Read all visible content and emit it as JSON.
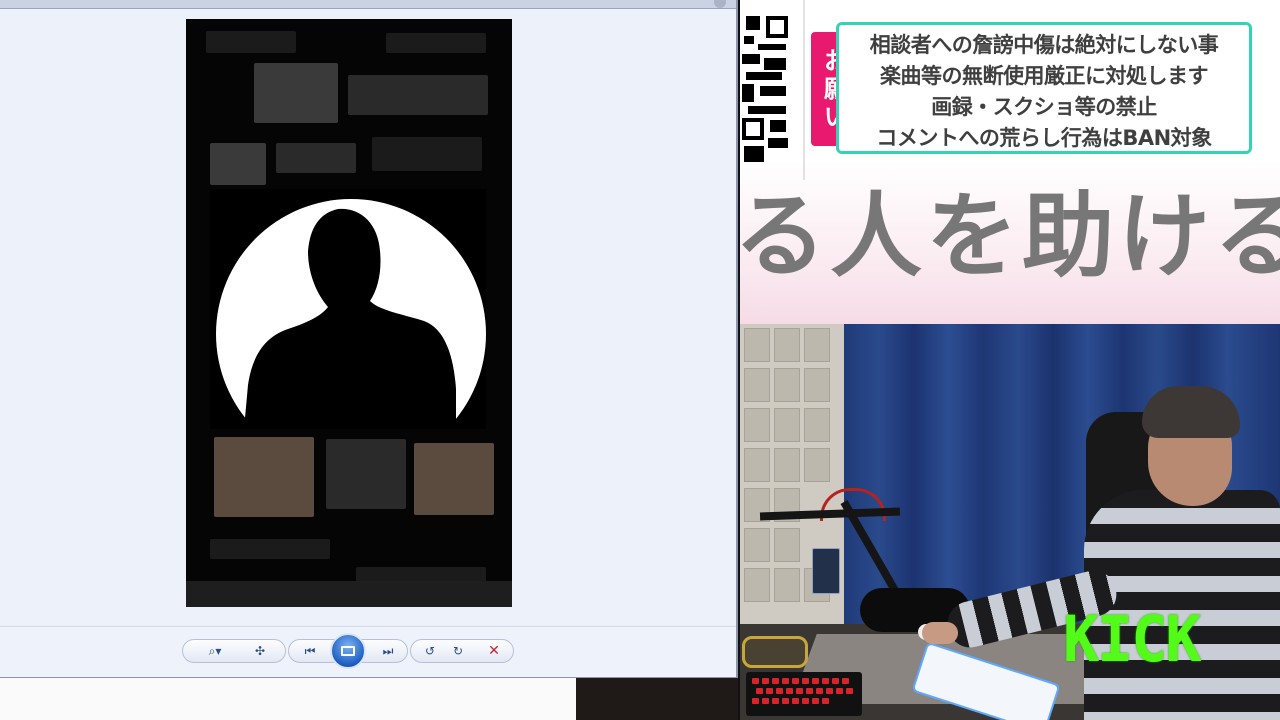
{
  "viewer": {
    "title": "· — ····· · — ·· ··· ·····"
  },
  "toolbar": {
    "zoom_label": "⌕▾",
    "fit_label": "✣",
    "prev_label": "⏮",
    "next_label": "⏭",
    "rotate_ccw_label": "↺",
    "rotate_cw_label": "↻",
    "delete_label": "✕"
  },
  "banner": {
    "onegai": [
      "お",
      "願",
      "い"
    ],
    "rules": [
      "相談者への詹謗中傷は絶対にしない事",
      "楽曲等の無断使用厳正に対処します",
      "画録・スクショ等の禁止",
      "コメントへの荒らし行為はBAN対象"
    ],
    "big_text": "る人を助ける"
  },
  "stream": {
    "platform_logo": "KICK",
    "logo_color": "#53fc18"
  },
  "colors": {
    "rules_border": "#35d3b6",
    "onegai_bg": "#e8196e",
    "viewer_bg": "#edf1f9"
  }
}
